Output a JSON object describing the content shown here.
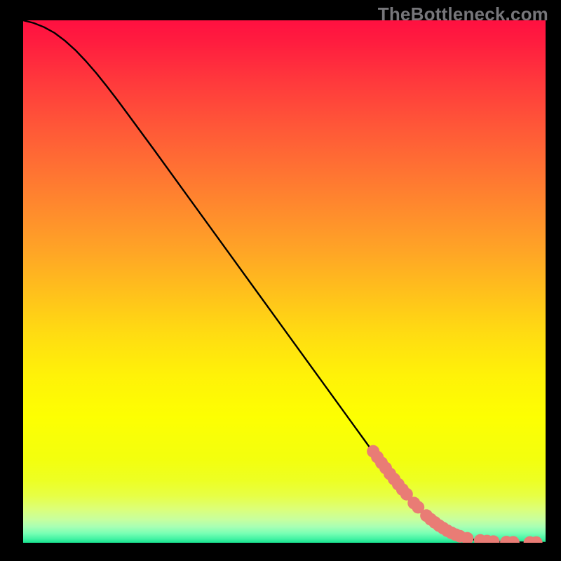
{
  "watermark": "TheBottleneck.com",
  "colors": {
    "marker": "#e97c75",
    "line": "#000000",
    "gradient": [
      {
        "stop": 0.0,
        "color": "#ff1040"
      },
      {
        "stop": 0.04,
        "color": "#ff1c3f"
      },
      {
        "stop": 0.12,
        "color": "#ff3a3c"
      },
      {
        "stop": 0.2,
        "color": "#ff5638"
      },
      {
        "stop": 0.28,
        "color": "#ff7033"
      },
      {
        "stop": 0.36,
        "color": "#ff8a2d"
      },
      {
        "stop": 0.44,
        "color": "#ffa426"
      },
      {
        "stop": 0.52,
        "color": "#ffc01c"
      },
      {
        "stop": 0.6,
        "color": "#ffdc12"
      },
      {
        "stop": 0.68,
        "color": "#fff208"
      },
      {
        "stop": 0.76,
        "color": "#fdff02"
      },
      {
        "stop": 0.84,
        "color": "#f3ff0e"
      },
      {
        "stop": 0.88,
        "color": "#edff23"
      },
      {
        "stop": 0.91,
        "color": "#e7ff45"
      },
      {
        "stop": 0.935,
        "color": "#dcff78"
      },
      {
        "stop": 0.955,
        "color": "#c8ff9e"
      },
      {
        "stop": 0.97,
        "color": "#a6ffb4"
      },
      {
        "stop": 0.982,
        "color": "#78ffb4"
      },
      {
        "stop": 0.992,
        "color": "#46f4a5"
      },
      {
        "stop": 1.0,
        "color": "#18e38f"
      }
    ]
  },
  "chart_data": {
    "type": "line",
    "title": "",
    "xlabel": "",
    "ylabel": "",
    "xlim": [
      0,
      100
    ],
    "ylim": [
      0,
      100
    ],
    "series": [
      {
        "name": "bottleneck-curve",
        "x": [
          0,
          2,
          4,
          6,
          8,
          10,
          12,
          14,
          16,
          18,
          20,
          25,
          30,
          35,
          40,
          45,
          50,
          55,
          60,
          65,
          70,
          75,
          80,
          85,
          88,
          90,
          92,
          94,
          96,
          98,
          100
        ],
        "y": [
          100,
          99.5,
          98.7,
          97.6,
          96.1,
          94.3,
          92.2,
          89.9,
          87.4,
          84.8,
          82.1,
          75.3,
          68.4,
          61.5,
          54.6,
          47.7,
          40.8,
          33.9,
          27.0,
          20.1,
          13.2,
          6.8,
          2.6,
          0.8,
          0.35,
          0.22,
          0.15,
          0.1,
          0.07,
          0.04,
          0.0
        ]
      }
    ],
    "highlighted_points": {
      "x": [
        67.0,
        67.8,
        68.6,
        69.4,
        70.2,
        71.0,
        71.8,
        72.6,
        73.4,
        74.8,
        75.6,
        77.2,
        78.0,
        78.8,
        79.6,
        80.4,
        81.2,
        82.0,
        82.8,
        83.6,
        85.0,
        87.5,
        88.8,
        90.0,
        92.5,
        93.8,
        97.0,
        98.2
      ],
      "y": [
        17.5,
        16.4,
        15.3,
        14.3,
        13.2,
        12.2,
        11.2,
        10.2,
        9.3,
        7.6,
        6.8,
        5.2,
        4.5,
        3.9,
        3.3,
        2.8,
        2.3,
        1.9,
        1.55,
        1.25,
        0.85,
        0.45,
        0.32,
        0.22,
        0.12,
        0.09,
        0.05,
        0.04
      ]
    }
  }
}
